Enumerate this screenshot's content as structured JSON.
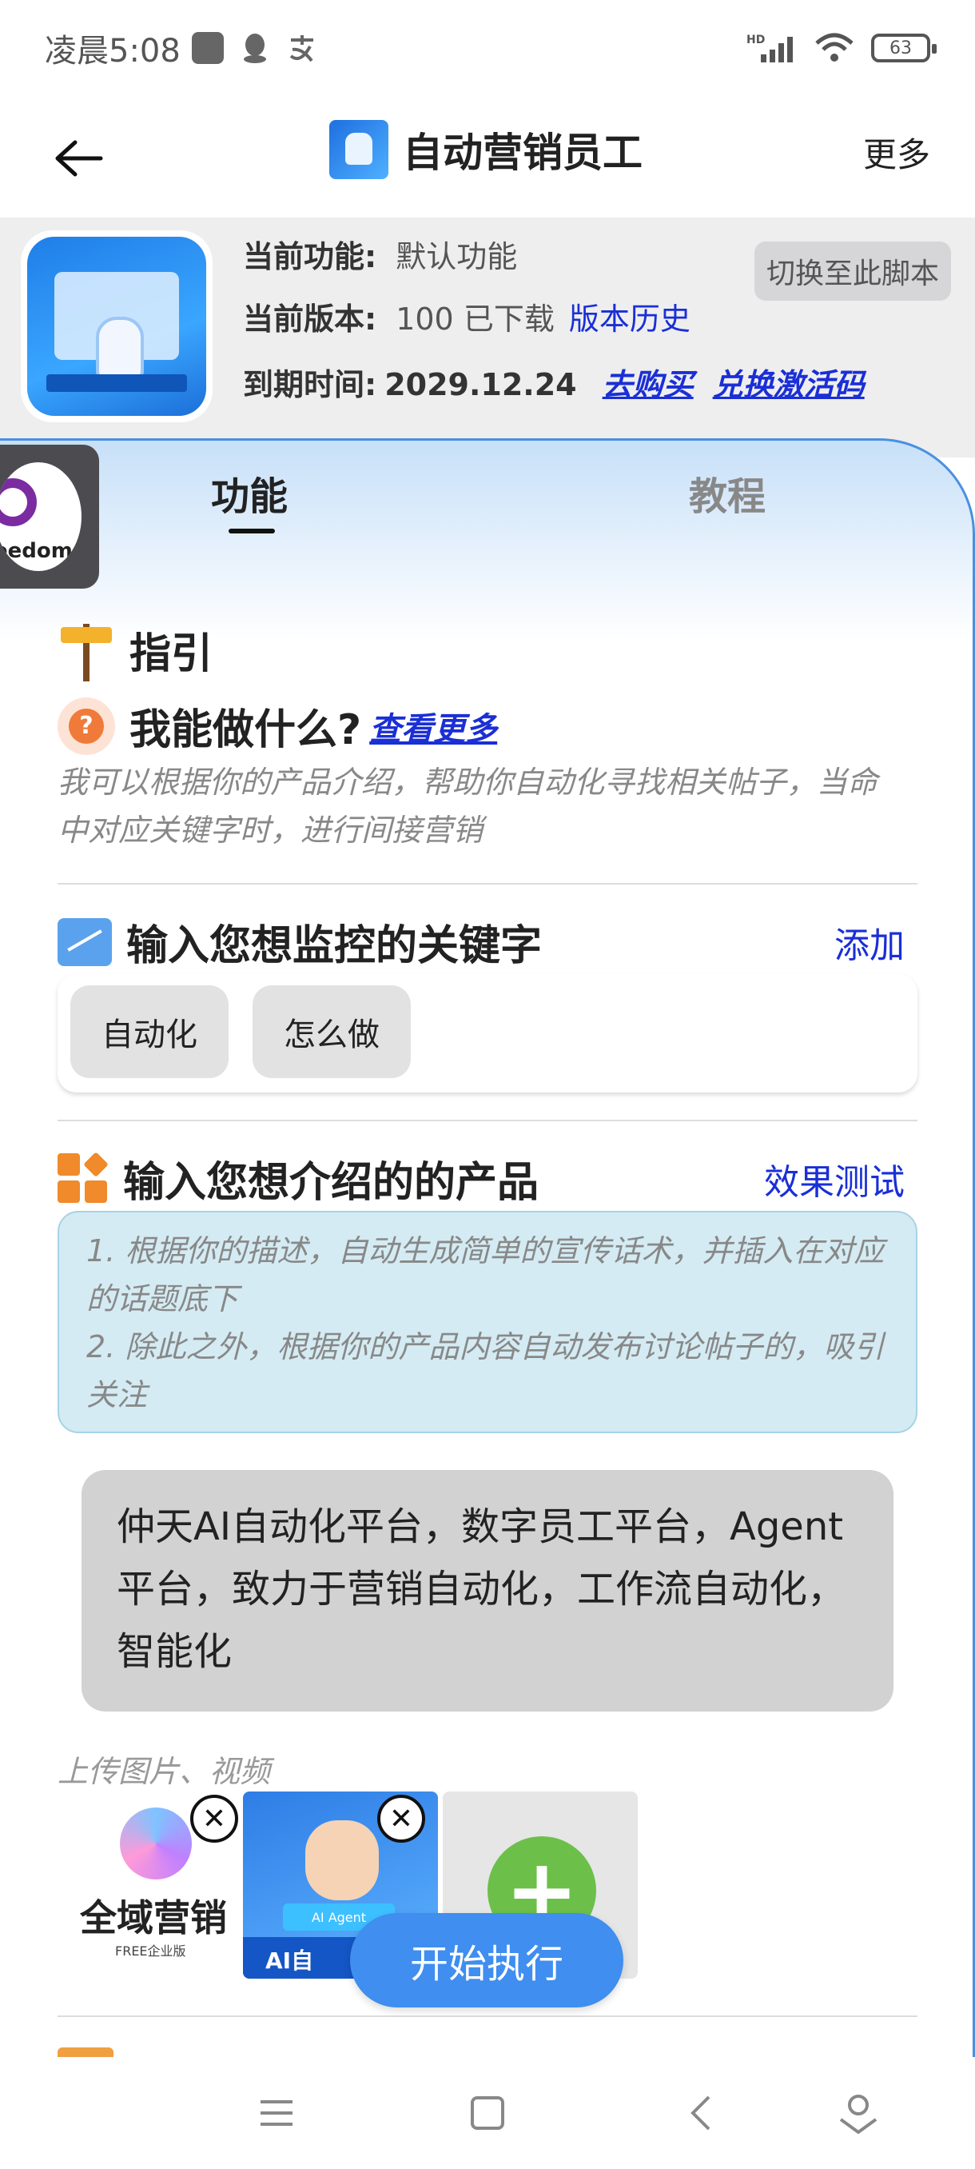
{
  "status_bar": {
    "time": "凌晨5:08",
    "network": "HD",
    "battery": "63"
  },
  "header": {
    "title": "自动营销员工",
    "more": "更多"
  },
  "info": {
    "func_label": "当前功能:",
    "func_value": "默认功能",
    "ver_label": "当前版本:",
    "ver_value": "100 已下载",
    "ver_history": "版本历史",
    "expire_label": "到期时间:",
    "expire_value": "2029.12.24",
    "buy": "去购买",
    "redeem": "兑换激活码",
    "switch_btn": "切换至此脚本"
  },
  "tabs": [
    "功能",
    "教程"
  ],
  "floating_logo": {
    "text": "eedom"
  },
  "guide": {
    "title": "指引",
    "question": "我能做什么?",
    "more_link": "查看更多",
    "desc": "我可以根据你的产品介绍，帮助你自动化寻找相关帖子，当命中对应关键字时，进行间接营销"
  },
  "keywords": {
    "title": "输入您想监控的关键字",
    "add": "添加",
    "items": [
      "自动化",
      "怎么做"
    ]
  },
  "product": {
    "title": "输入您想介绍的的产品",
    "test": "效果测试",
    "note_line1": "1. 根据你的描述，自动生成简单的宣传话术，并插入在对应的话题底下",
    "note_line2": "2. 除此之外，根据你的产品内容自动发布讨论帖子的，吸引关注",
    "content": "仲天AI自动化平台，数字员工平台，Agent平台，致力于营销自动化，工作流自动化，智能化"
  },
  "upload": {
    "label": "上传图片、视频",
    "thumb1_title": "全域营销",
    "thumb1_sub": "FREE企业版",
    "thumb2_badge": "AI Agent",
    "thumb2_text": "AI自",
    "close_symbol": "✕",
    "add_symbol": "+"
  },
  "run_button": "开始执行",
  "colors": {
    "accent": "#3f8ef0",
    "link": "#1a2fd6",
    "panel_border": "#4a90e0"
  }
}
